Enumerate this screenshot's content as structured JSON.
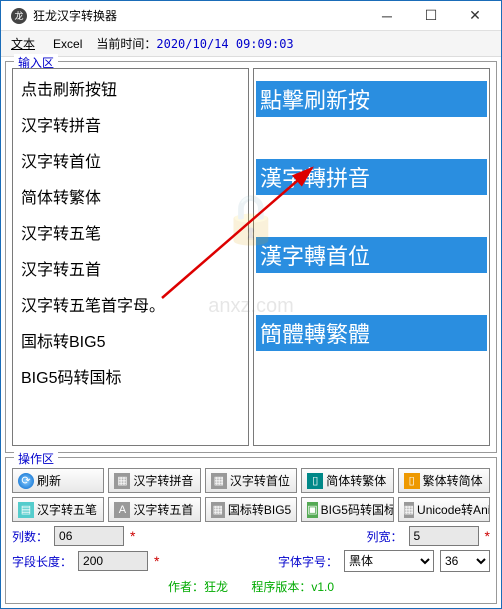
{
  "window": {
    "title": "狂龙汉字转换器"
  },
  "tabs": {
    "text": "文本",
    "excel": "Excel"
  },
  "time": {
    "label": "当前时间：",
    "value": "2020/10/14  09:09:03"
  },
  "input_section": {
    "label": "输入区"
  },
  "left_items": [
    "点击刷新按钮",
    "汉字转拼音",
    "汉字转首位",
    "简体转繁体",
    "汉字转五笔",
    "汉字转五首",
    "汉字转五笔首字母。",
    "国标转BIG5",
    "BIG5码转国标"
  ],
  "right_items": [
    {
      "text": "點擊刷新按",
      "sel": true
    },
    {
      "text": "",
      "sel": false
    },
    {
      "text": "漢字轉拼音",
      "sel": true
    },
    {
      "text": "",
      "sel": false
    },
    {
      "text": "漢字轉首位",
      "sel": true
    },
    {
      "text": "",
      "sel": false
    },
    {
      "text": "簡體轉繁體",
      "sel": true
    }
  ],
  "op_section": {
    "label": "操作区"
  },
  "buttons_row1": [
    {
      "label": "刷新",
      "icon": "icon-blue",
      "glyph": "⟳"
    },
    {
      "label": "汉字转拼音",
      "icon": "icon-gray",
      "glyph": "▦"
    },
    {
      "label": "汉字转首位",
      "icon": "icon-gray",
      "glyph": "▦"
    },
    {
      "label": "简体转繁体",
      "icon": "icon-teal",
      "glyph": "▯"
    },
    {
      "label": "繁体转简体",
      "icon": "icon-orange",
      "glyph": "▯"
    }
  ],
  "buttons_row2": [
    {
      "label": "汉字转五笔",
      "icon": "icon-cyan",
      "glyph": "▤"
    },
    {
      "label": "汉字转五首",
      "icon": "icon-gray",
      "glyph": "A"
    },
    {
      "label": "国标转BIG5",
      "icon": "icon-gray",
      "glyph": "▦"
    },
    {
      "label": "BIG5码转国标",
      "icon": "icon-green",
      "glyph": "▣"
    },
    {
      "label": "Unicode转Anisc",
      "icon": "icon-gray",
      "glyph": "▦"
    }
  ],
  "params": {
    "cols_label": "列数：",
    "cols_value": "06",
    "width_label": "列宽：",
    "width_value": "5",
    "fieldlen_label": "字段长度：",
    "fieldlen_value": "200",
    "fontsize_label": "字体字号：",
    "font_name": "黑体",
    "font_size": "36"
  },
  "footer": {
    "author_label": "作者：狂龙",
    "version_label": "程序版本：v1.0"
  },
  "watermark": {
    "icon": "🔒",
    "text": "anxz.com"
  }
}
